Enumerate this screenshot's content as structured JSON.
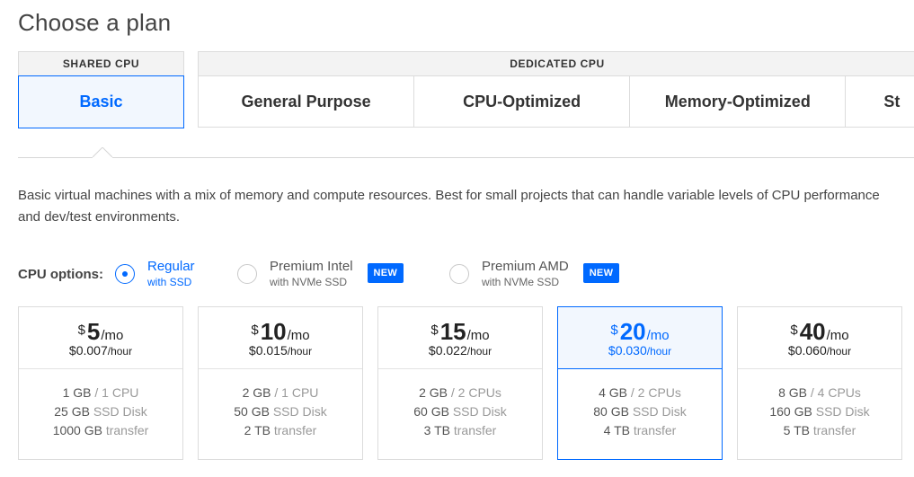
{
  "title": "Choose a plan",
  "shared_group": {
    "label": "SHARED CPU",
    "tabs": [
      {
        "label": "Basic",
        "active": true
      }
    ]
  },
  "dedicated_group": {
    "label": "DEDICATED CPU",
    "tabs": [
      {
        "label": "General Purpose"
      },
      {
        "label": "CPU-Optimized"
      },
      {
        "label": "Memory-Optimized"
      },
      {
        "label": "St"
      }
    ]
  },
  "description": {
    "line1": "Basic virtual machines with a mix of memory and compute resources. Best for small projects that can handle variable levels of CPU performance",
    "line2": "and dev/test environments."
  },
  "cpu_options": {
    "label": "CPU options:",
    "options": [
      {
        "name": "Regular",
        "sub": "with SSD",
        "selected": true,
        "badge": ""
      },
      {
        "name": "Premium Intel",
        "sub": "with NVMe SSD",
        "selected": false,
        "badge": "NEW"
      },
      {
        "name": "Premium AMD",
        "sub": "with NVMe SSD",
        "selected": false,
        "badge": "NEW"
      }
    ]
  },
  "plans": [
    {
      "currency": "$",
      "amount": "5",
      "per": "/mo",
      "hourly": "$0.007",
      "hourly_unit": "/hour",
      "memory": "1 GB",
      "cpus": "/ 1 CPU",
      "disk": "25 GB",
      "disk_label": "SSD Disk",
      "transfer": "1000 GB",
      "transfer_label": "transfer",
      "selected": false
    },
    {
      "currency": "$",
      "amount": "10",
      "per": "/mo",
      "hourly": "$0.015",
      "hourly_unit": "/hour",
      "memory": "2 GB",
      "cpus": "/ 1 CPU",
      "disk": "50 GB",
      "disk_label": "SSD Disk",
      "transfer": "2 TB",
      "transfer_label": "transfer",
      "selected": false
    },
    {
      "currency": "$",
      "amount": "15",
      "per": "/mo",
      "hourly": "$0.022",
      "hourly_unit": "/hour",
      "memory": "2 GB",
      "cpus": "/ 2 CPUs",
      "disk": "60 GB",
      "disk_label": "SSD Disk",
      "transfer": "3 TB",
      "transfer_label": "transfer",
      "selected": false
    },
    {
      "currency": "$",
      "amount": "20",
      "per": "/mo",
      "hourly": "$0.030",
      "hourly_unit": "/hour",
      "memory": "4 GB",
      "cpus": "/ 2 CPUs",
      "disk": "80 GB",
      "disk_label": "SSD Disk",
      "transfer": "4 TB",
      "transfer_label": "transfer",
      "selected": true
    },
    {
      "currency": "$",
      "amount": "40",
      "per": "/mo",
      "hourly": "$0.060",
      "hourly_unit": "/hour",
      "memory": "8 GB",
      "cpus": "/ 4 CPUs",
      "disk": "160 GB",
      "disk_label": "SSD Disk",
      "transfer": "5 TB",
      "transfer_label": "transfer",
      "selected": false
    }
  ],
  "colors": {
    "accent": "#0069ff",
    "selected_bg": "#f2f7fe",
    "border": "#dcdcdc"
  }
}
